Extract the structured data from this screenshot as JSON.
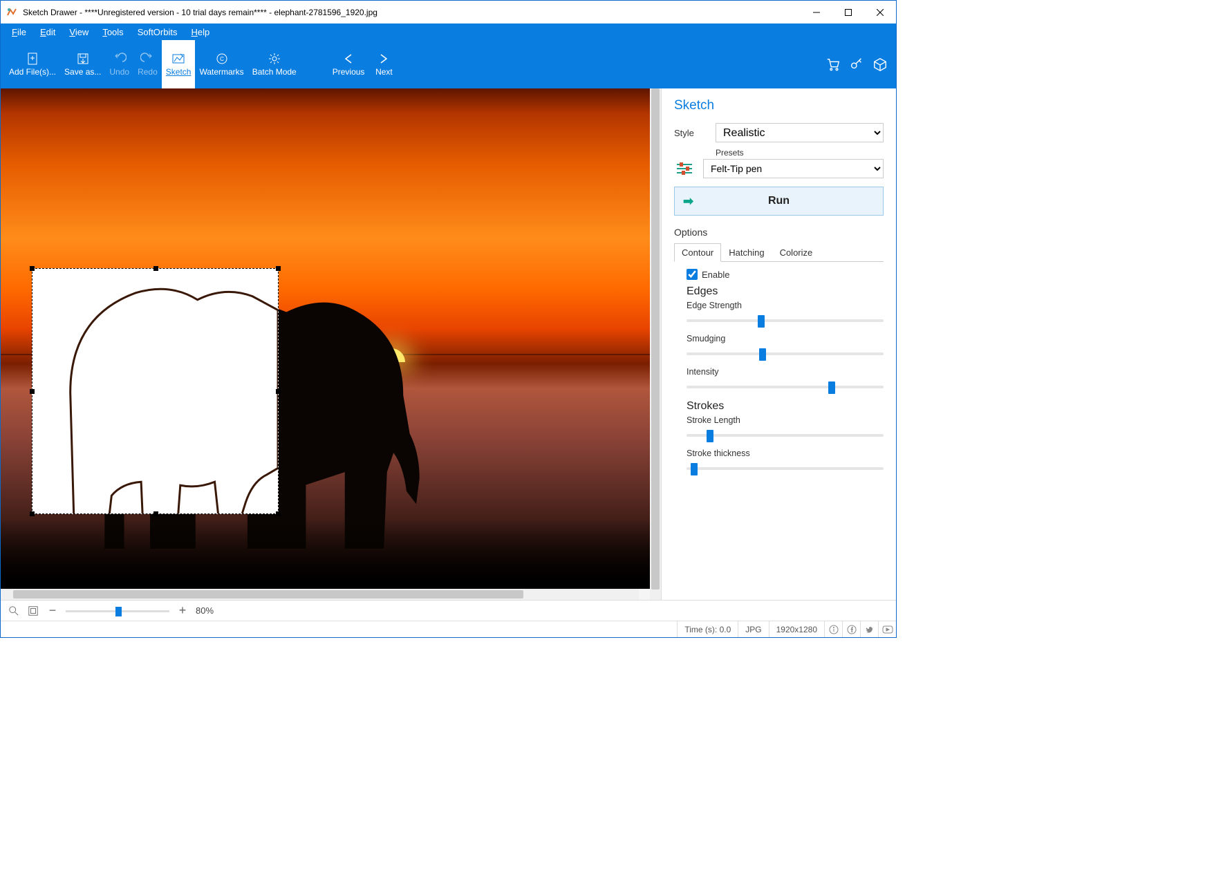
{
  "titlebar": {
    "title": "Sketch Drawer - ****Unregistered version - 10 trial days remain**** - elephant-2781596_1920.jpg"
  },
  "menu": {
    "file": "File",
    "edit": "Edit",
    "view": "View",
    "tools": "Tools",
    "softorbits": "SoftOrbits",
    "help": "Help"
  },
  "toolbar": {
    "addfiles": "Add File(s)...",
    "saveas": "Save as...",
    "undo": "Undo",
    "redo": "Redo",
    "sketch": "Sketch",
    "watermarks": "Watermarks",
    "batch": "Batch Mode",
    "previous": "Previous",
    "next": "Next"
  },
  "panel": {
    "title": "Sketch",
    "style_label": "Style",
    "style_value": "Realistic",
    "presets_label": "Presets",
    "preset_value": "Felt-Tip pen",
    "run": "Run",
    "options": "Options",
    "tabs": {
      "contour": "Contour",
      "hatching": "Hatching",
      "colorize": "Colorize"
    },
    "enable": "Enable",
    "edges": "Edges",
    "edge_strength": "Edge Strength",
    "smudging": "Smudging",
    "intensity": "Intensity",
    "strokes": "Strokes",
    "stroke_length": "Stroke Length",
    "stroke_thickness": "Stroke thickness",
    "sliders": {
      "edge_strength": 36,
      "smudging": 37,
      "intensity": 72,
      "stroke_length": 10,
      "stroke_thickness": 2
    }
  },
  "zoom": {
    "percent": "80%",
    "slider": 48
  },
  "status": {
    "time": "Time (s): 0.0",
    "format": "JPG",
    "dims": "1920x1280"
  }
}
